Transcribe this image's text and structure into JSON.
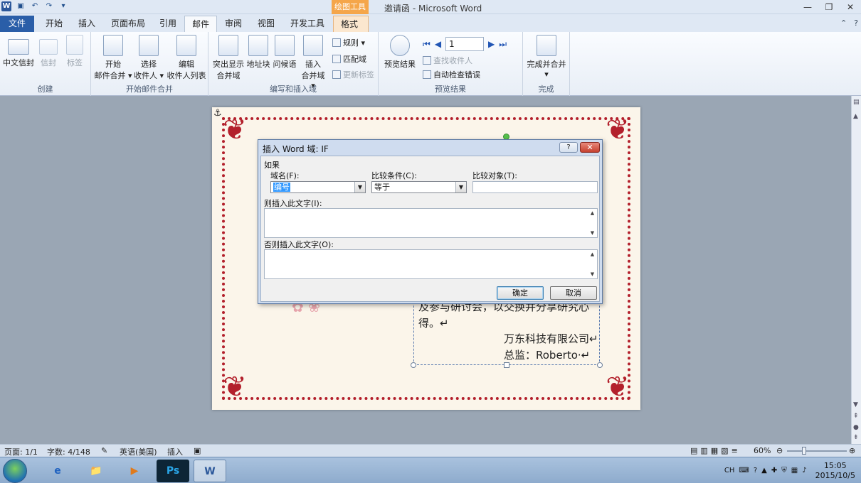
{
  "window": {
    "title": "邀请函 - Microsoft Word",
    "context_tool_header": "绘图工具"
  },
  "tabs": [
    "文件",
    "开始",
    "插入",
    "页面布局",
    "引用",
    "邮件",
    "审阅",
    "视图",
    "开发工具",
    "格式"
  ],
  "ribbon": {
    "create": {
      "label": "创建",
      "buttons": [
        "中文信封",
        "信封",
        "标签"
      ]
    },
    "start_merge": {
      "label": "开始邮件合并",
      "buttons": [
        {
          "l1": "开始",
          "l2": "邮件合并 ▾"
        },
        {
          "l1": "选择",
          "l2": "收件人 ▾"
        },
        {
          "l1": "编辑",
          "l2": "收件人列表"
        }
      ]
    },
    "write_insert": {
      "label": "编写和插入域",
      "buttons": [
        {
          "l1": "突出显示",
          "l2": "合并域"
        },
        {
          "l1": "地址块",
          "l2": ""
        },
        {
          "l1": "问候语",
          "l2": ""
        },
        {
          "l1": "插入",
          "l2": "合并域 ▾"
        }
      ],
      "small": [
        "规则 ▾",
        "匹配域",
        "更新标签"
      ]
    },
    "preview": {
      "label": "预览结果",
      "button": "预览结果",
      "record_value": "1",
      "small": [
        "查找收件人",
        "自动检查错误"
      ]
    },
    "finish": {
      "label": "完成",
      "button_l1": "完成并合并",
      "button_l2": "▾"
    }
  },
  "document": {
    "line1": "及参与研讨会，以交换并分享研究心",
    "line2": "得。↵",
    "line3": "万东科技有限公司↵",
    "line4": "总监：Roberto·↵"
  },
  "dialog": {
    "title": "插入 Word 域: IF",
    "help": "?",
    "close": "✕",
    "if_label": "如果",
    "field_name_label": "域名(F):",
    "field_name_value": "编号",
    "compare_label": "比较条件(C):",
    "compare_value": "等于",
    "compare_to_label": "比较对象(T):",
    "compare_to_value": "",
    "then_label": "则插入此文字(I):",
    "else_label": "否则插入此文字(O):",
    "ok": "确定",
    "cancel": "取消"
  },
  "statusbar": {
    "page": "页面: 1/1",
    "words": "字数: 4/148",
    "language": "英语(美国)",
    "mode": "插入",
    "zoom": "60%"
  },
  "taskbar": {
    "ime": "CH",
    "time": "15:05",
    "date": "2015/10/5",
    "apps": [
      "e",
      "📁",
      "▶",
      "Ps",
      "W"
    ]
  }
}
